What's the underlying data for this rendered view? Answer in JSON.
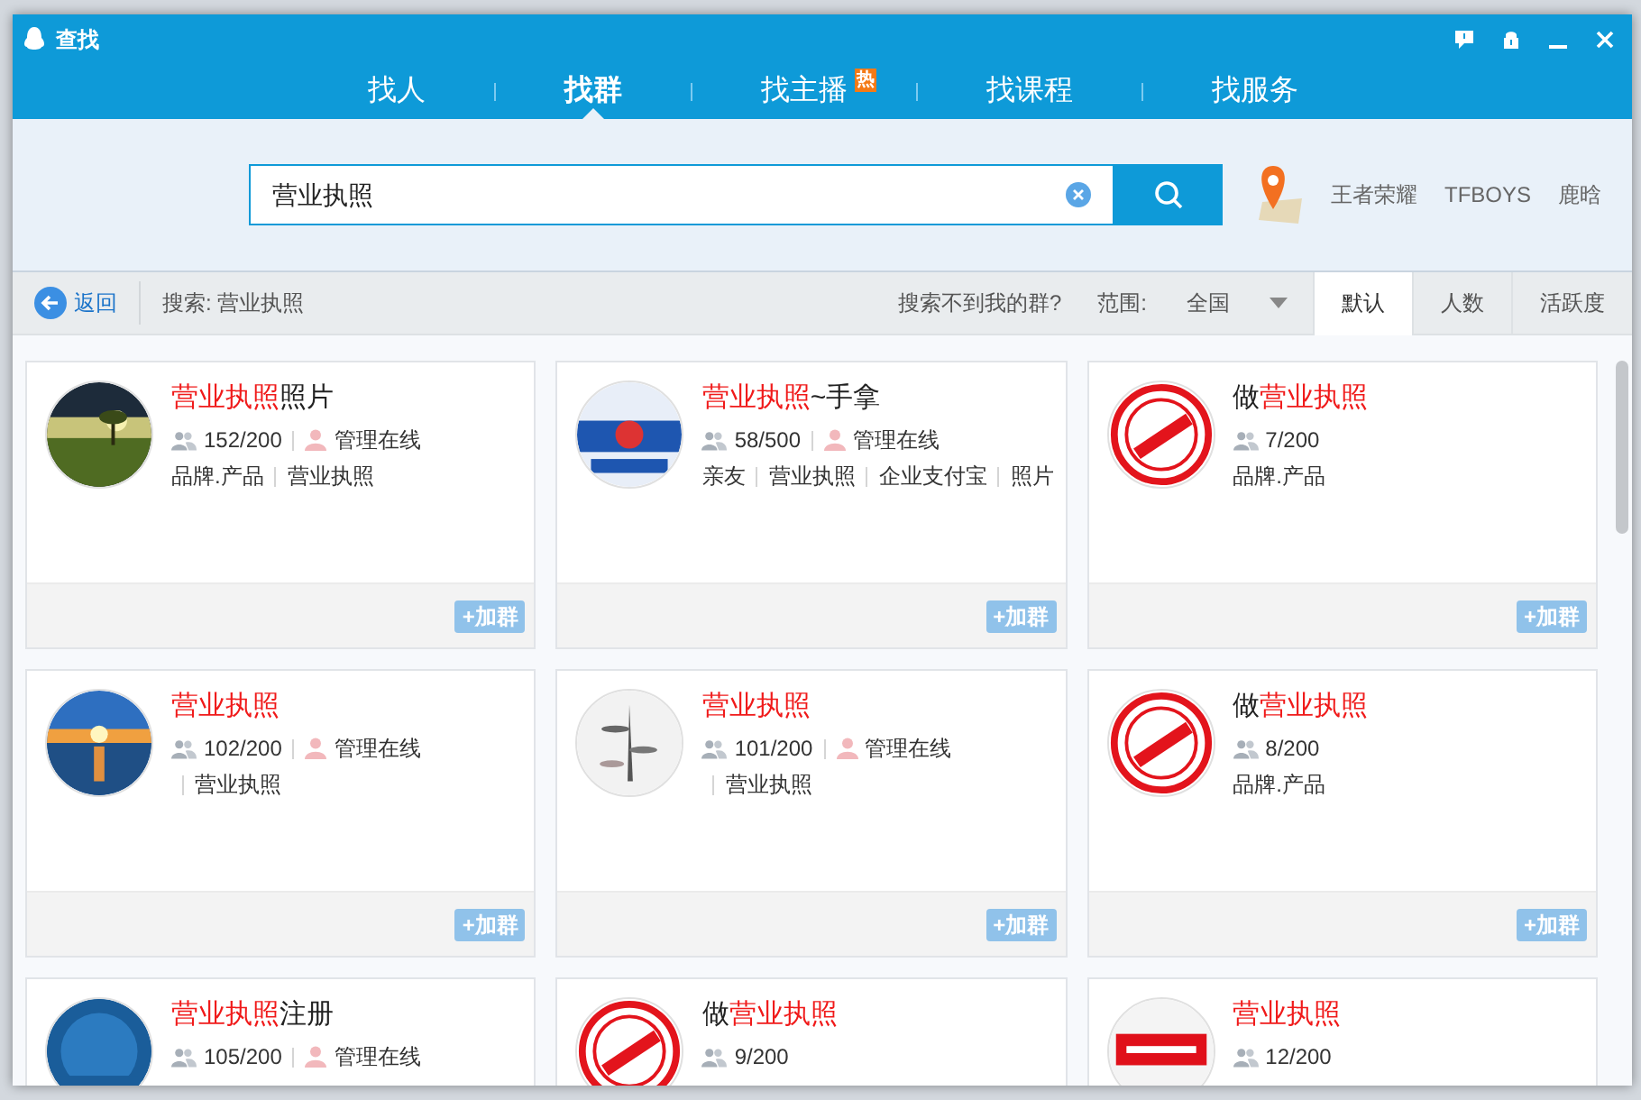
{
  "window": {
    "title": "查找"
  },
  "tabs": [
    {
      "label": "找人",
      "selected": false
    },
    {
      "label": "找群",
      "selected": true
    },
    {
      "label": "找主播",
      "selected": false,
      "badge": "热"
    },
    {
      "label": "找课程",
      "selected": false
    },
    {
      "label": "找服务",
      "selected": false
    }
  ],
  "search": {
    "value": "营业执照"
  },
  "hot_words": [
    "王者荣耀",
    "TFBOYS",
    "鹿晗"
  ],
  "toolbar": {
    "back": "返回",
    "query": "搜索: 营业执照",
    "not_found": "搜索不到我的群?",
    "scope_label": "范围:",
    "scope": "全国",
    "sort_tabs": [
      {
        "label": "默认",
        "selected": true
      },
      {
        "label": "人数",
        "selected": false
      },
      {
        "label": "活跃度",
        "selected": false
      }
    ]
  },
  "groups": [
    {
      "title": [
        {
          "text": "营业执照",
          "highlight": true
        },
        {
          "text": "照片",
          "highlight": false
        }
      ],
      "members": "152/200",
      "admin": "管理在线",
      "tags": [
        "品牌.产品",
        "营业执照"
      ],
      "lead_divider": false,
      "join": "+加群"
    },
    {
      "title": [
        {
          "text": "营业执照",
          "highlight": true
        },
        {
          "text": "~手拿",
          "highlight": false
        }
      ],
      "members": "58/500",
      "admin": "管理在线",
      "tags": [
        "亲友",
        "营业执照",
        "企业支付宝",
        "照片"
      ],
      "lead_divider": false,
      "join": "+加群"
    },
    {
      "title": [
        {
          "text": "做",
          "highlight": false
        },
        {
          "text": "营业执照",
          "highlight": true
        }
      ],
      "members": "7/200",
      "tags": [
        "品牌.产品"
      ],
      "lead_divider": false,
      "join": "+加群"
    },
    {
      "title": [
        {
          "text": "营业执照",
          "highlight": true
        }
      ],
      "members": "102/200",
      "admin": "管理在线",
      "tags": [
        "营业执照"
      ],
      "lead_divider": true,
      "join": "+加群"
    },
    {
      "title": [
        {
          "text": "营业执照",
          "highlight": true
        }
      ],
      "members": "101/200",
      "admin": "管理在线",
      "tags": [
        "营业执照"
      ],
      "lead_divider": true,
      "join": "+加群"
    },
    {
      "title": [
        {
          "text": "做",
          "highlight": false
        },
        {
          "text": "营业执照",
          "highlight": true
        }
      ],
      "members": "8/200",
      "tags": [
        "品牌.产品"
      ],
      "lead_divider": false,
      "join": "+加群"
    },
    {
      "title": [
        {
          "text": "营业执照",
          "highlight": true
        },
        {
          "text": "注册",
          "highlight": false
        }
      ],
      "members": "105/200",
      "admin": "管理在线"
    },
    {
      "title": [
        {
          "text": "做",
          "highlight": false
        },
        {
          "text": "营业执照",
          "highlight": true
        }
      ],
      "members": "9/200"
    },
    {
      "title": [
        {
          "text": "营业执照",
          "highlight": true
        }
      ],
      "members": "12/200"
    }
  ]
}
